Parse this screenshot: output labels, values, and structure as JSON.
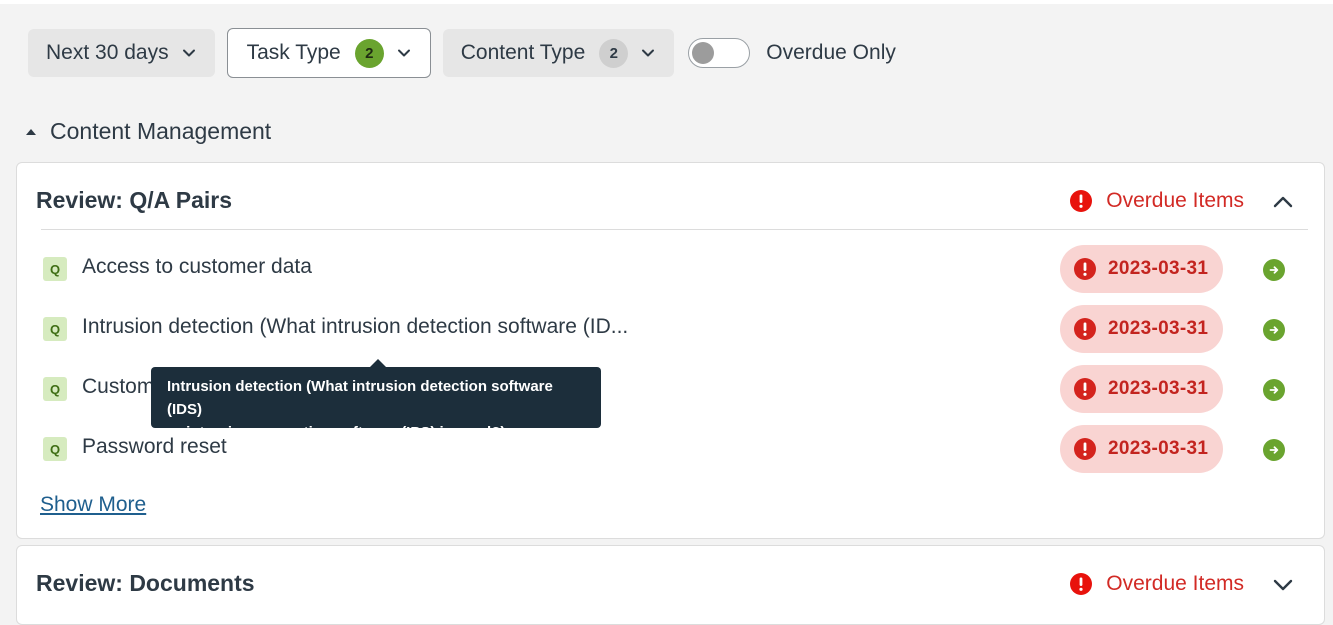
{
  "filters": {
    "date_range": {
      "label": "Next 30 days",
      "icon": "chevron-down-icon"
    },
    "task_type": {
      "label": "Task Type",
      "count": "2",
      "icon": "chevron-down-icon",
      "count_color": "#6aa42f"
    },
    "content_type": {
      "label": "Content Type",
      "count": "2",
      "icon": "chevron-down-icon"
    },
    "overdue_only": {
      "label": "Overdue Only",
      "checked": false
    }
  },
  "section": {
    "title": "Content Management",
    "icon": "caret-up-icon"
  },
  "cards": [
    {
      "title": "Review: Q/A Pairs",
      "overdue_label": "Overdue Items",
      "expanded": true,
      "rows": [
        {
          "badge": "Q",
          "text": "Access to customer data",
          "date": "2023-03-31"
        },
        {
          "badge": "Q",
          "text": "Intrusion detection (What intrusion detection software (ID...",
          "date": "2023-03-31"
        },
        {
          "badge": "Q",
          "text": "Custom",
          "date": "2023-03-31"
        },
        {
          "badge": "Q",
          "text": "Password reset",
          "date": "2023-03-31"
        }
      ],
      "show_more": "Show More"
    },
    {
      "title": "Review: Documents",
      "overdue_label": "Overdue Items",
      "expanded": false
    }
  ],
  "tooltip": {
    "line1": "Intrusion detection (What intrusion detection software (IDS)",
    "line2": "or intrusion prevention software (IPS) is used?)"
  },
  "colors": {
    "accent_green": "#6aa42f",
    "overdue_red": "#d22a25",
    "date_pill_bg": "#f9d4d2",
    "tooltip_bg": "#1c2e3b"
  }
}
